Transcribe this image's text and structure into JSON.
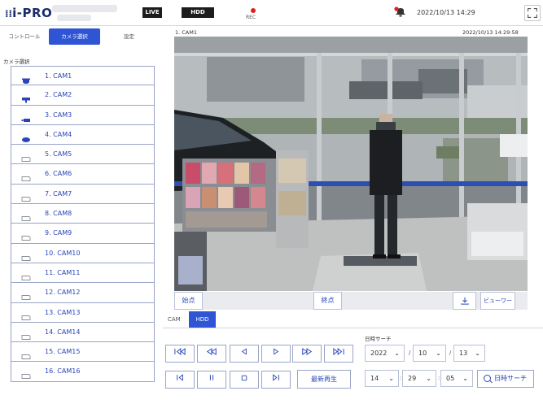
{
  "header": {
    "brand": "i-PRO",
    "live_badge": "LIVE",
    "hdd_badge": "HDD",
    "rec_label": "REC",
    "datetime": "2022/10/13 14:29"
  },
  "left_panel": {
    "tabs": [
      "コントロール",
      "カメラ選択",
      "設定"
    ],
    "active_tab": "カメラ選択",
    "section_label": "カメラ選択",
    "cameras": [
      {
        "label": "1. CAM1",
        "icon": "dome-camera-icon"
      },
      {
        "label": "2. CAM2",
        "icon": "box-camera-icon"
      },
      {
        "label": "3. CAM3",
        "icon": "bullet-camera-icon"
      },
      {
        "label": "4. CAM4",
        "icon": "ptz-camera-icon"
      },
      {
        "label": "5. CAM5",
        "icon": "camera-outline-icon"
      },
      {
        "label": "6. CAM6",
        "icon": "camera-outline-icon"
      },
      {
        "label": "7. CAM7",
        "icon": "camera-outline-icon"
      },
      {
        "label": "8. CAM8",
        "icon": "camera-outline-icon"
      },
      {
        "label": "9. CAM9",
        "icon": "camera-outline-icon"
      },
      {
        "label": "10. CAM10",
        "icon": "camera-outline-icon"
      },
      {
        "label": "11. CAM11",
        "icon": "camera-outline-icon"
      },
      {
        "label": "12. CAM12",
        "icon": "camera-outline-icon"
      },
      {
        "label": "13. CAM13",
        "icon": "camera-outline-icon"
      },
      {
        "label": "14. CAM14",
        "icon": "camera-outline-icon"
      },
      {
        "label": "15. CAM15",
        "icon": "camera-outline-icon"
      },
      {
        "label": "16. CAM16",
        "icon": "camera-outline-icon"
      }
    ]
  },
  "video": {
    "camera_title": "1. CAM1",
    "timestamp": "2022/10/13 14:29:58"
  },
  "clip_bar": {
    "start_label": "始点",
    "end_label": "終点",
    "viewer_label": "ビューワー"
  },
  "source_tabs": {
    "cam_label": "CAM",
    "hdd_label": "HDD",
    "active": "HDD"
  },
  "playback": {
    "latest_label": "最新再生"
  },
  "date_search": {
    "label": "日時サーチ",
    "year": "2022",
    "month": "10",
    "day": "13",
    "hour": "14",
    "minute": "29",
    "second": "05",
    "date_separator": "/",
    "time_separator": ":",
    "search_label": "日時サーチ"
  },
  "colors": {
    "accent": "#2f55d4",
    "link_text": "#2a44b8",
    "rec": "#e02020",
    "badge_bg": "#1c1c1c"
  }
}
